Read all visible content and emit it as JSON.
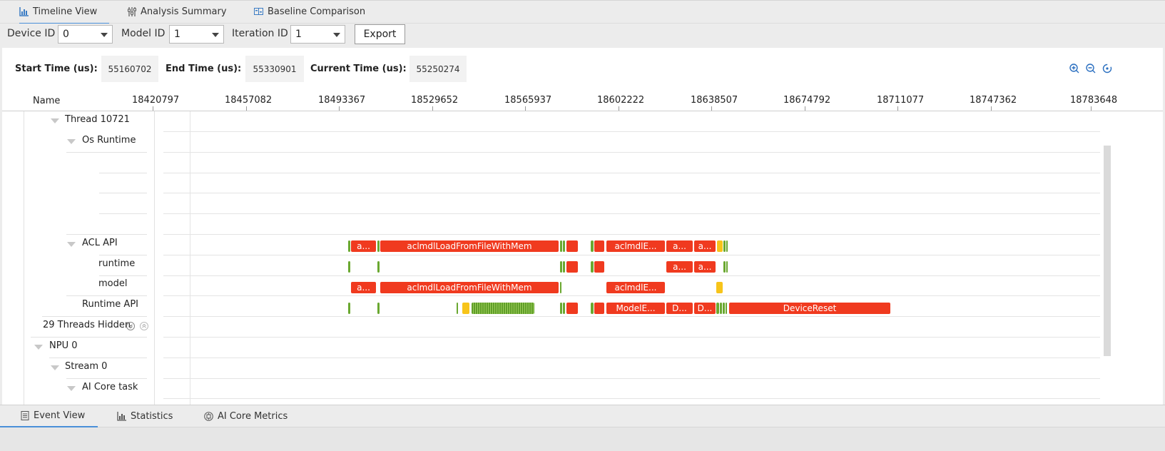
{
  "top_tabs": [
    {
      "label": "Timeline View",
      "icon": "bar-chart-icon",
      "active": true
    },
    {
      "label": "Analysis Summary",
      "icon": "sliders-icon",
      "active": false
    },
    {
      "label": "Baseline Comparison",
      "icon": "compare-icon",
      "active": false
    }
  ],
  "controls": {
    "device_label": "Device ID",
    "device_value": "0",
    "model_label": "Model ID",
    "model_value": "1",
    "iteration_label": "Iteration ID",
    "iteration_value": "1",
    "export_label": "Export"
  },
  "times": {
    "start_label": "Start Time (us):",
    "start_value": "55160702",
    "end_label": "End Time (us):",
    "end_value": "55330901",
    "current_label": "Current Time (us):",
    "current_value": "55250274"
  },
  "zoom_icons": [
    "zoom-in-icon",
    "zoom-out-icon",
    "reset-zoom-icon"
  ],
  "axis": {
    "name_header": "Name",
    "ticks": [
      "18420797",
      "18457082",
      "18493367",
      "18529652",
      "18565937",
      "18602222",
      "18638507",
      "18674792",
      "18711077",
      "18747362",
      "18783648"
    ]
  },
  "tree": {
    "thread": "Thread 10721",
    "os_runtime": "Os Runtime",
    "acl_api": "ACL API",
    "runtime": "runtime",
    "model": "model",
    "runtime_api": "Runtime API",
    "threads_hidden": "29 Threads Hidden",
    "npu": "NPU 0",
    "stream": "Stream 0",
    "ai_core_task": "AI Core task"
  },
  "bars": {
    "acl_a1": "a...",
    "acl_load": "aclmdlLoadFromFileWithMem",
    "acl_exec": "aclmdlE...",
    "acl_a2": "a...",
    "acl_a3": "a...",
    "rt_a1": "a...",
    "rt_a2": "a...",
    "model_a1": "a...",
    "model_load": "aclmdlLoadFromFileWithMem",
    "model_exec": "aclmdlE...",
    "rapi_modelexec": "ModelE...",
    "rapi_d1": "D...",
    "rapi_d2": "D...",
    "rapi_reset": "DeviceReset"
  },
  "colors": {
    "long_event": "#f03a1f",
    "short_event": "#6aa830",
    "warning_event": "#f7c41a",
    "accent": "#4a90d9"
  },
  "bottom_tabs": [
    {
      "label": "Event View",
      "icon": "document-icon",
      "active": true
    },
    {
      "label": "Statistics",
      "icon": "bar-chart-icon",
      "active": false
    },
    {
      "label": "AI Core Metrics",
      "icon": "chip-icon",
      "active": false
    }
  ]
}
